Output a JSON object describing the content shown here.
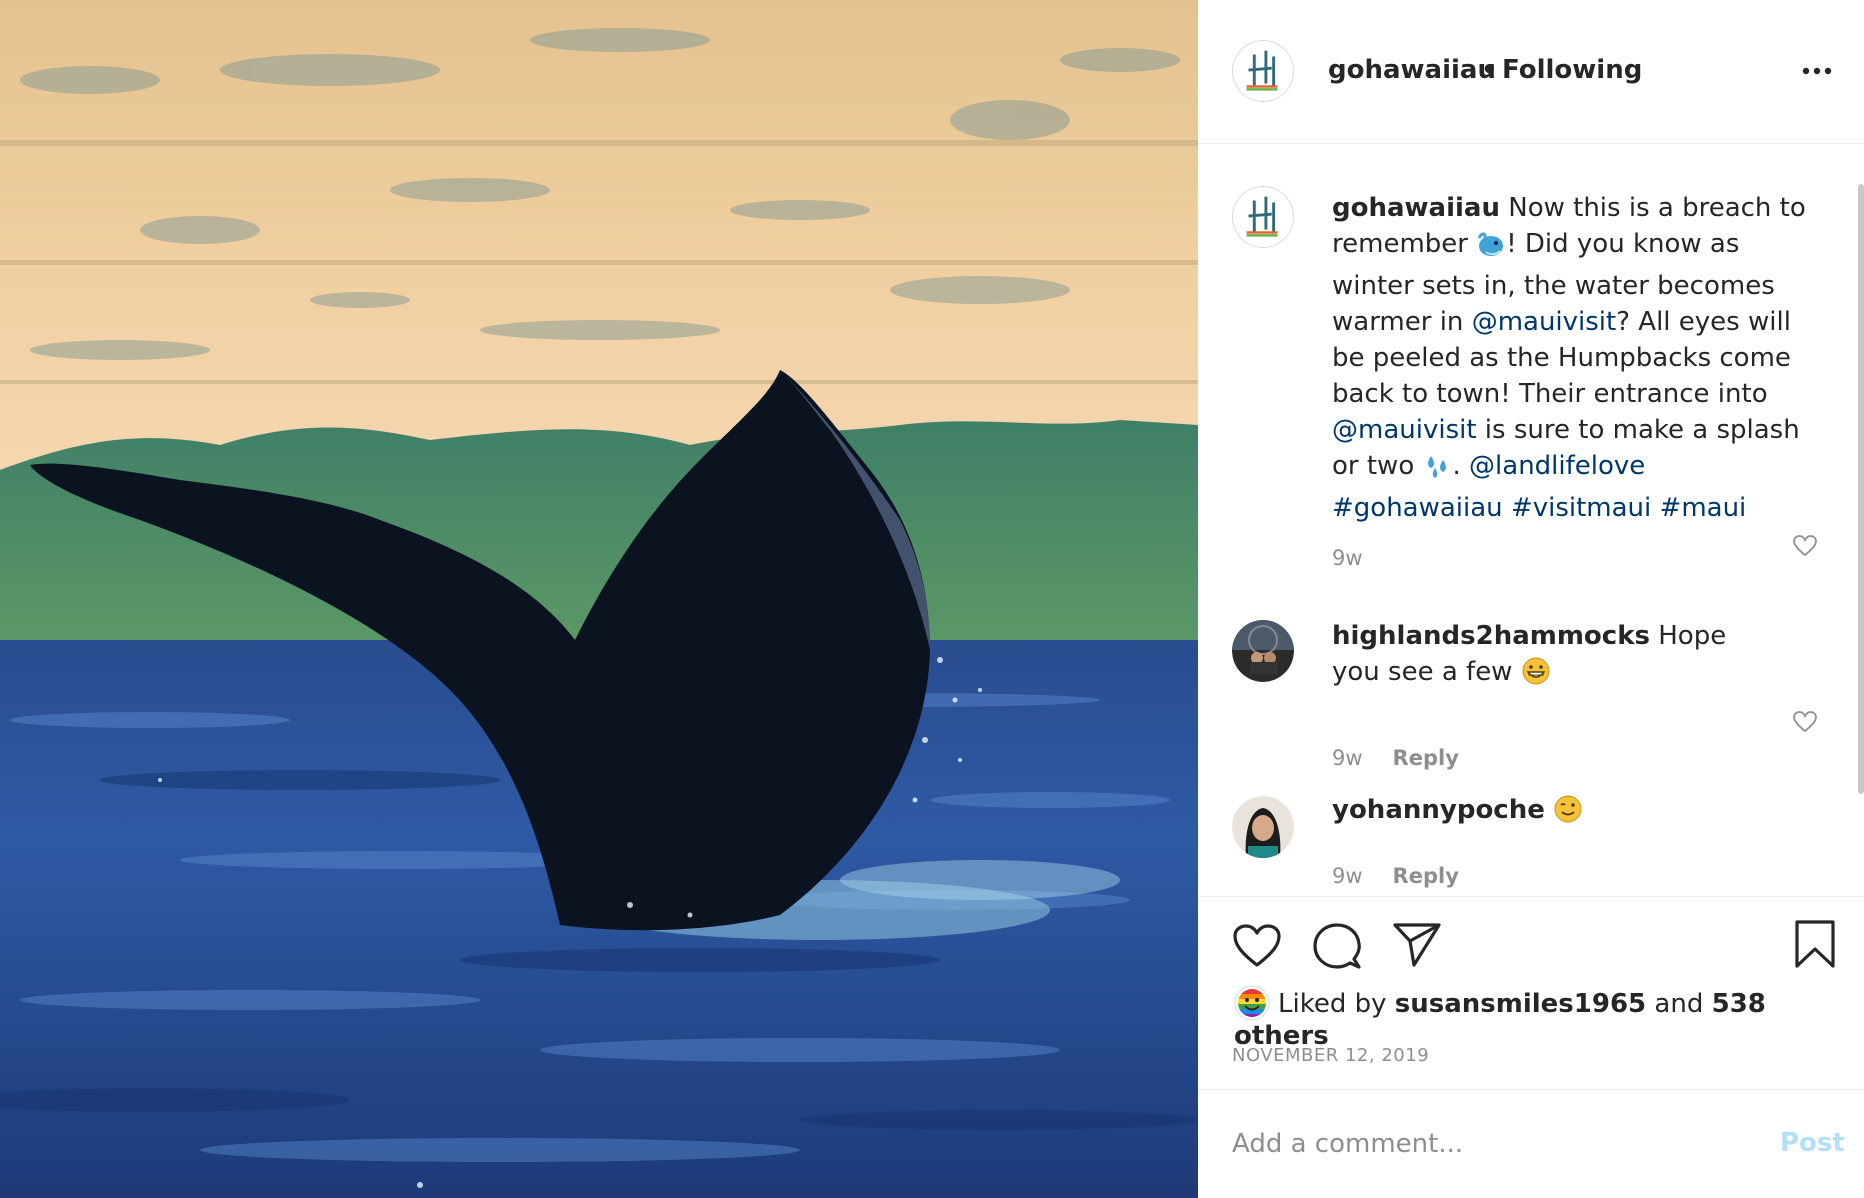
{
  "post": {
    "username": "gohawaiiau",
    "separator": "•",
    "follow_status": "Following",
    "more_icon": "more-options-icon"
  },
  "caption": {
    "username": "gohawaiiau",
    "text_1": "Now this is a breach to remember ",
    "emoji_1": "whale-emoji",
    "text_2": "! Did you know as winter sets in, the water becomes warmer in ",
    "mention_1": "@mauivisit",
    "text_3": "? All eyes will be peeled as the Humpbacks come back to town! Their entrance into ",
    "mention_2": "@mauivisit",
    "text_4": " is sure to make a splash or two ",
    "emoji_2": "splash-emoji",
    "text_5": ". ",
    "mention_3": "@landlifelove",
    "hashtags": [
      "#gohawaiiau",
      "#visitmaui",
      "#maui"
    ],
    "time": "9w"
  },
  "comments": [
    {
      "username": "highlands2hammocks",
      "text": "Hope you see a few ",
      "emoji": "grinning-emoji",
      "time": "9w",
      "reply": "Reply"
    },
    {
      "username": "yohannypoche",
      "text": "",
      "emoji": "winking-emoji",
      "time": "9w",
      "reply": "Reply"
    }
  ],
  "actions": {
    "likes_prefix": "Liked by ",
    "liked_user": "susansmiles1965",
    "likes_and": " and ",
    "likes_others": "538 others",
    "date": "NOVEMBER 12, 2019"
  },
  "add_comment": {
    "placeholder": "Add a comment...",
    "post_label": "Post"
  },
  "colors": {
    "link": "#00376b",
    "secondary_text": "#8e8e8e",
    "post_button_disabled": "#b2dffc"
  }
}
